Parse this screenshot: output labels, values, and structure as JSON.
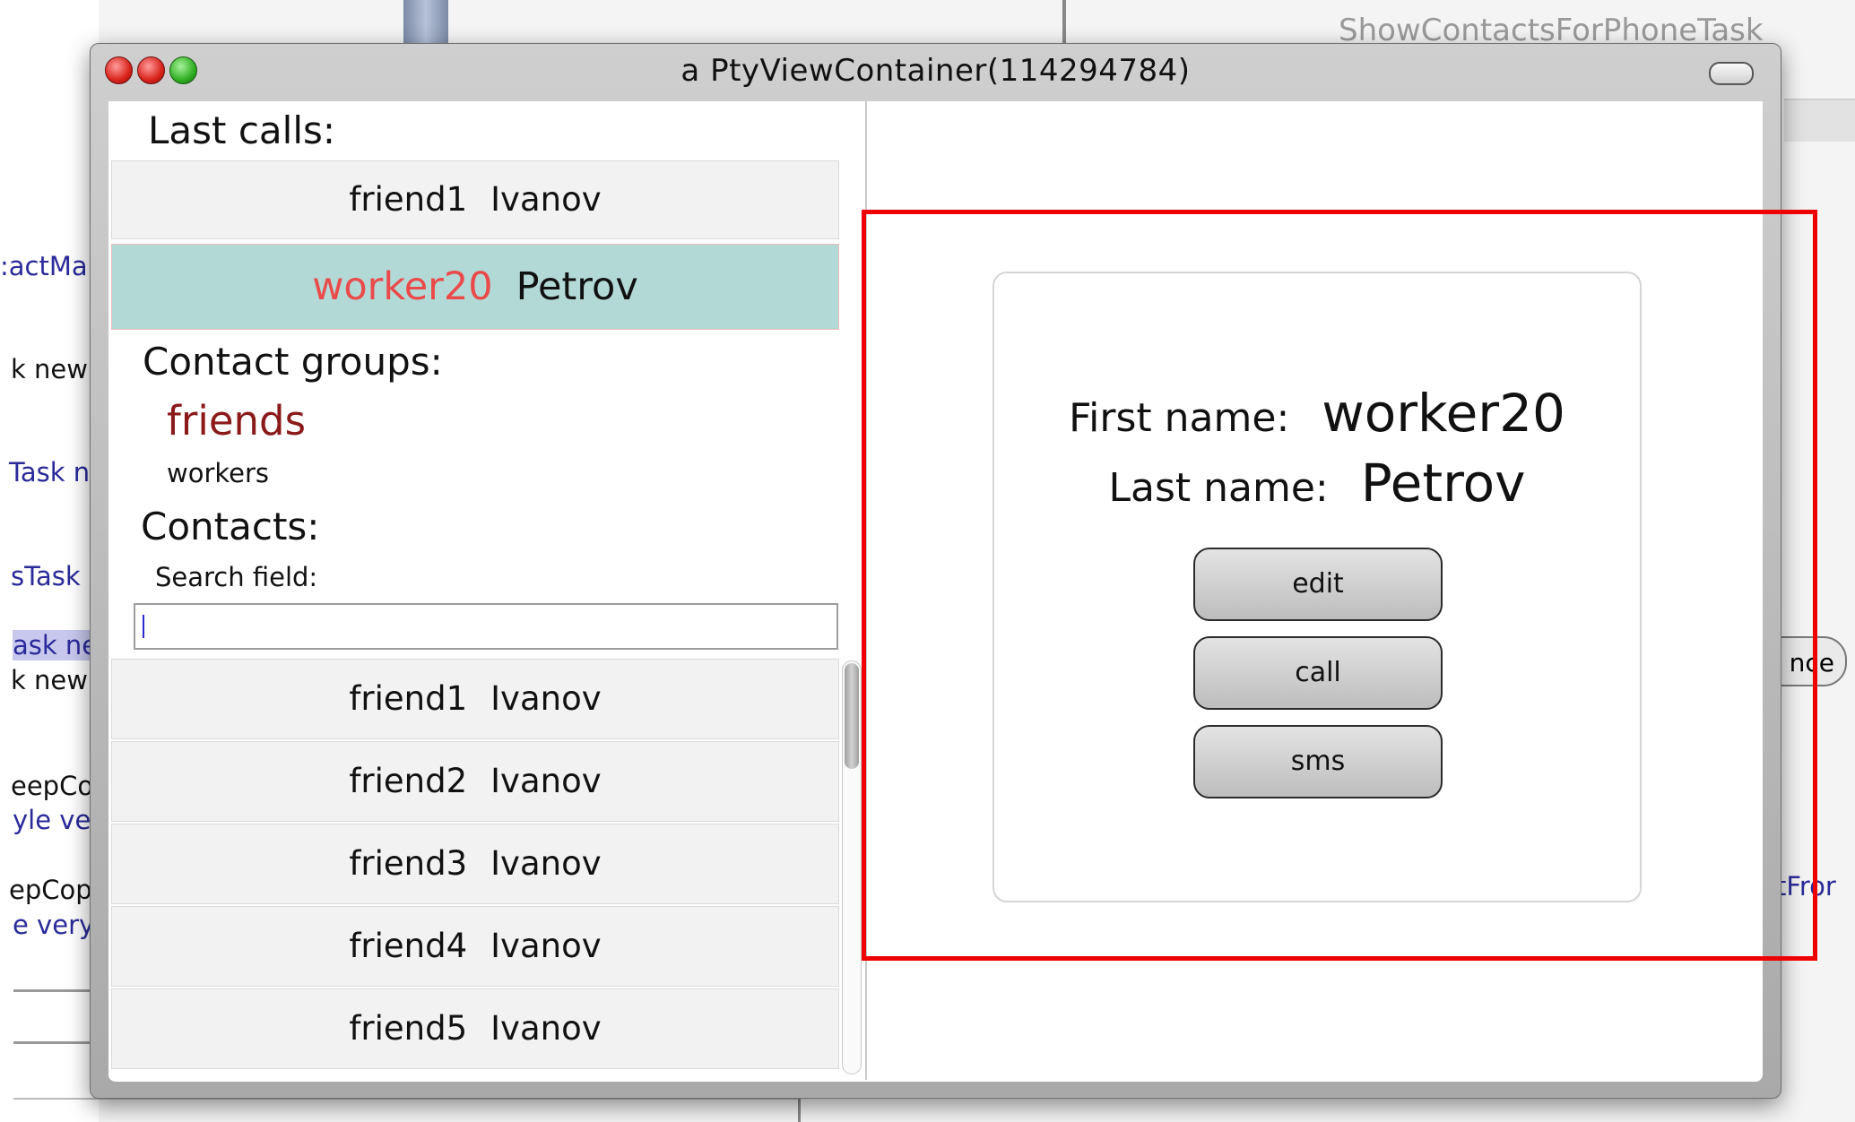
{
  "background_window": {
    "title": "ShowContactsForPhoneTask",
    "fragments": [
      ":actMa",
      "k new",
      "Task n",
      "sTask",
      "ask ne",
      "k new",
      "eepCo",
      "yle ve",
      "epCop",
      "e very",
      "nce",
      "ctFror"
    ]
  },
  "window": {
    "title": "a PtyViewContainer(114294784)"
  },
  "last_calls": {
    "title": "Last calls:",
    "items": [
      {
        "first": "friend1",
        "last": "Ivanov"
      },
      {
        "first": "worker20",
        "last": "Petrov"
      }
    ]
  },
  "contact_groups": {
    "title": "Contact groups:",
    "items": [
      "friends",
      "workers"
    ]
  },
  "contacts": {
    "title": "Contacts:",
    "search_label": "Search field:",
    "search_value": "",
    "items": [
      {
        "first": "friend1",
        "last": "Ivanov"
      },
      {
        "first": "friend2",
        "last": "Ivanov"
      },
      {
        "first": "friend3",
        "last": "Ivanov"
      },
      {
        "first": "friend4",
        "last": "Ivanov"
      },
      {
        "first": "friend5",
        "last": "Ivanov"
      }
    ]
  },
  "details": {
    "first_name_label": "First name:",
    "first_name_value": "worker20",
    "last_name_label": "Last name:",
    "last_name_value": "Petrov",
    "buttons": {
      "edit": "edit",
      "call": "call",
      "sms": "sms"
    }
  },
  "colors": {
    "selected_row_bg": "#b3d9d7",
    "selected_first_name": "#ea4a4a",
    "active_group": "#8b1a1a",
    "annotation_box": "#ee0000"
  }
}
